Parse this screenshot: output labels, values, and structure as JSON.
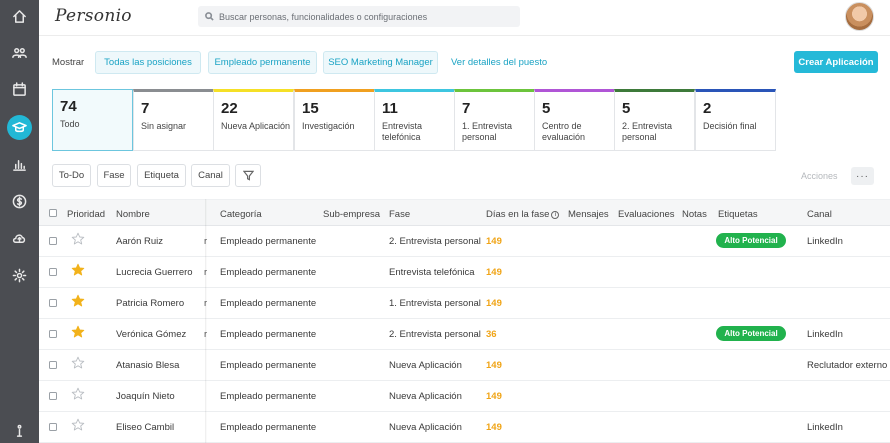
{
  "sidebar": {
    "icons": [
      "home-icon",
      "people-icon",
      "calendar-icon",
      "recruiting-icon",
      "analytics-icon",
      "payroll-icon",
      "upload-icon",
      "settings-icon",
      "info-icon"
    ]
  },
  "topbar": {
    "logo": "Personio",
    "search_placeholder": "Buscar personas, funcionalidades o configuraciones"
  },
  "filters": {
    "label": "Mostrar",
    "pills": [
      "Todas las posiciones",
      "Empleado permanente",
      "SEO Marketing Manager"
    ],
    "details_link": "Ver detalles del puesto",
    "create_button": "Crear Aplicación"
  },
  "stages": [
    {
      "count": "74",
      "name": "Todo",
      "color": "#ffffff"
    },
    {
      "count": "7",
      "name": "Sin asignar",
      "color": "#8a8d91"
    },
    {
      "count": "22",
      "name": "Nueva Aplicación",
      "color": "#f5e026"
    },
    {
      "count": "15",
      "name": "Investigación",
      "color": "#f0a020"
    },
    {
      "count": "11",
      "name": "Entrevista telefónica",
      "color": "#3ec6e0"
    },
    {
      "count": "7",
      "name": "1. Entrevista personal",
      "color": "#6cc43c"
    },
    {
      "count": "5",
      "name": "Centro de evaluación",
      "color": "#b055d6"
    },
    {
      "count": "5",
      "name": "2. Entrevista personal",
      "color": "#3e7a3a"
    },
    {
      "count": "2",
      "name": "Decisión final",
      "color": "#2a55b8"
    }
  ],
  "toolbar": {
    "buttons": [
      "To-Do",
      "Fase",
      "Etiqueta",
      "Canal"
    ],
    "actions_label": "Acciones",
    "more_label": "···"
  },
  "table": {
    "headers": {
      "prioridad": "Prioridad",
      "nombre": "Nombre",
      "categoria": "Categoría",
      "subempresa": "Sub-empresa",
      "fase": "Fase",
      "dias": "Días en la fase",
      "mensajes": "Mensajes",
      "evaluaciones": "Evaluaciones",
      "notas": "Notas",
      "etiquetas": "Etiquetas",
      "canal": "Canal"
    },
    "rows": [
      {
        "starred": false,
        "name": "Aarón Ruiz",
        "trunc": "r",
        "category": "Empleado permanente",
        "phase": "2. Entrevista personal",
        "days": "149",
        "tag": "Alto Potencial",
        "channel": "LinkedIn"
      },
      {
        "starred": true,
        "name": "Lucrecia Guerrero",
        "trunc": "r",
        "category": "Empleado permanente",
        "phase": "Entrevista telefónica",
        "days": "149",
        "tag": "",
        "channel": ""
      },
      {
        "starred": true,
        "name": "Patricia Romero",
        "trunc": "r",
        "category": "Empleado permanente",
        "phase": "1. Entrevista personal",
        "days": "149",
        "tag": "",
        "channel": ""
      },
      {
        "starred": true,
        "name": "Verónica Gómez",
        "trunc": "r",
        "category": "Empleado permanente",
        "phase": "2. Entrevista personal",
        "days": "36",
        "tag": "Alto Potencial",
        "channel": "LinkedIn"
      },
      {
        "starred": false,
        "name": "Atanasio Blesa",
        "trunc": "",
        "category": "Empleado permanente",
        "phase": "Nueva Aplicación",
        "days": "149",
        "tag": "",
        "channel": "Reclutador externo"
      },
      {
        "starred": false,
        "name": "Joaquín Nieto",
        "trunc": "",
        "category": "Empleado permanente",
        "phase": "Nueva Aplicación",
        "days": "149",
        "tag": "",
        "channel": ""
      },
      {
        "starred": false,
        "name": "Eliseo Cambil",
        "trunc": "",
        "category": "Empleado permanente",
        "phase": "Nueva Aplicación",
        "days": "149",
        "tag": "",
        "channel": "LinkedIn"
      }
    ]
  },
  "colors": {
    "accent": "#25b9d8",
    "star": "#f2b21b",
    "badge": "#21b24d",
    "days": "#f0a416",
    "sidebar": "#4b4d52"
  }
}
